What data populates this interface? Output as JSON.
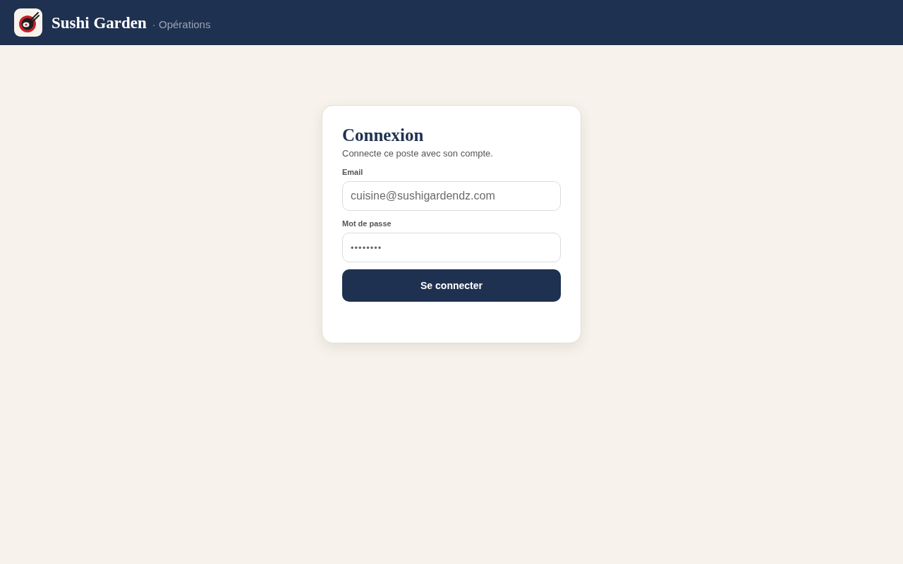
{
  "header": {
    "brand": "Sushi Garden",
    "section": "· Opérations"
  },
  "login": {
    "title": "Connexion",
    "subtitle": "Connecte ce poste avec son compte.",
    "fields": [
      {
        "kind": "email",
        "label": "Email",
        "value": "cuisine@sushigardendz.com"
      },
      {
        "kind": "password",
        "label": "Mot de passe",
        "value": "••••••••"
      }
    ],
    "submit": "Se connecter"
  }
}
